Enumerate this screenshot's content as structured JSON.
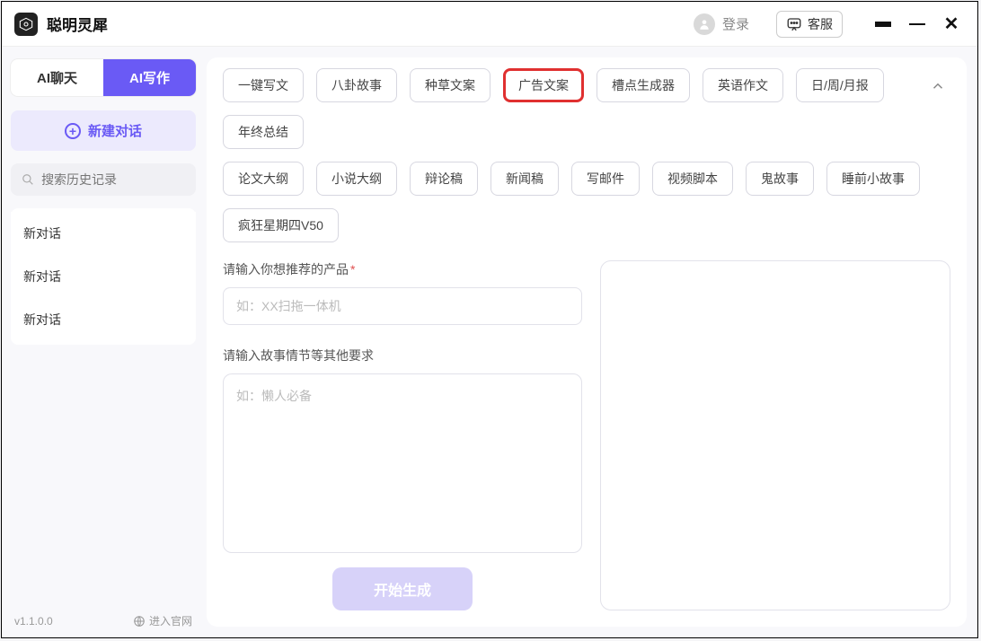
{
  "titlebar": {
    "app_name": "聪明灵犀",
    "login_label": "登录",
    "cs_label": "客服"
  },
  "sidebar": {
    "tabs": {
      "chat": "AI聊天",
      "write": "AI写作"
    },
    "new_chat": "新建对话",
    "search_placeholder": "搜索历史记录",
    "history": [
      "新对话",
      "新对话",
      "新对话"
    ],
    "version": "v1.1.0.0",
    "official": "进入官网"
  },
  "chips_row1": [
    "一键写文",
    "八卦故事",
    "种草文案",
    "广告文案",
    "槽点生成器",
    "英语作文",
    "日/周/月报",
    "年终总结"
  ],
  "chips_row2": [
    "论文大纲",
    "小说大纲",
    "辩论稿",
    "新闻稿",
    "写邮件",
    "视频脚本",
    "鬼故事",
    "睡前小故事",
    "疯狂星期四V50"
  ],
  "highlighted_chip_index": 3,
  "form": {
    "label_product": "请输入你想推荐的产品",
    "placeholder_product": "如：XX扫拖一体机",
    "label_other": "请输入故事情节等其他要求",
    "placeholder_other": "如：懒人必备",
    "generate": "开始生成"
  }
}
